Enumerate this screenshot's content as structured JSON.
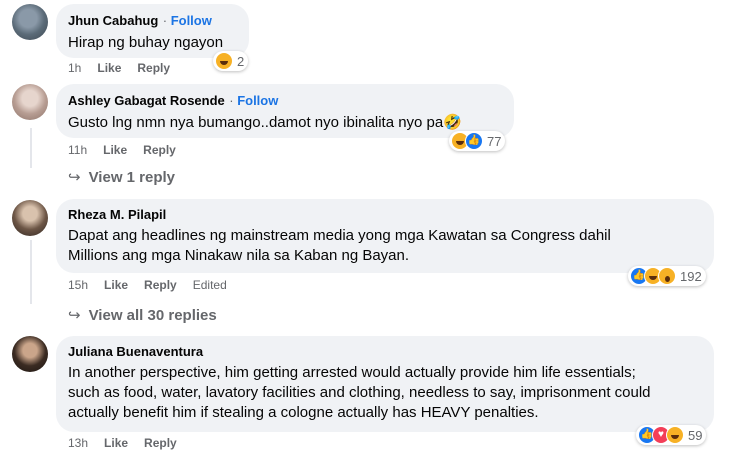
{
  "comments": [
    {
      "name": "Jhun Cabahug",
      "follow": "Follow",
      "text": "Hirap ng buhay ngayon",
      "time": "1h",
      "like": "Like",
      "reply": "Reply",
      "reaction_count": "2",
      "reactions": [
        "haha"
      ]
    },
    {
      "name": "Ashley Gabagat Rosende",
      "follow": "Follow",
      "text": "Gusto lng nmn nya bumango..damot nyo ibinalita nyo pa🤣",
      "time": "11h",
      "like": "Like",
      "reply": "Reply",
      "reaction_count": "77",
      "reactions": [
        "haha",
        "like"
      ],
      "view_replies": "View 1 reply"
    },
    {
      "name": "Rheza M. Pilapil",
      "text_lines": [
        "Dapat ang headlines ng mainstream media yong mga Kawatan sa Congress dahil",
        "Millions ang mga Ninakaw nila sa Kaban ng Bayan."
      ],
      "time": "15h",
      "like": "Like",
      "reply": "Reply",
      "edited": "Edited",
      "reaction_count": "192",
      "reactions": [
        "like",
        "haha",
        "wow"
      ],
      "view_replies": "View all 30 replies"
    },
    {
      "name": "Juliana Buenaventura",
      "text_lines": [
        "In another perspective, him getting arrested would actually provide him life essentials;",
        "such as food, water, lavatory facilities and clothing, needless to say, imprisonment could",
        "actually benefit him if stealing a cologne actually has HEAVY penalties."
      ],
      "time": "13h",
      "like": "Like",
      "reply": "Reply",
      "reaction_count": "59",
      "reactions": [
        "like",
        "love",
        "haha"
      ]
    }
  ],
  "colors": {
    "bubble": "#f0f2f5",
    "follow": "#1b74e4",
    "meta": "#65676b"
  }
}
